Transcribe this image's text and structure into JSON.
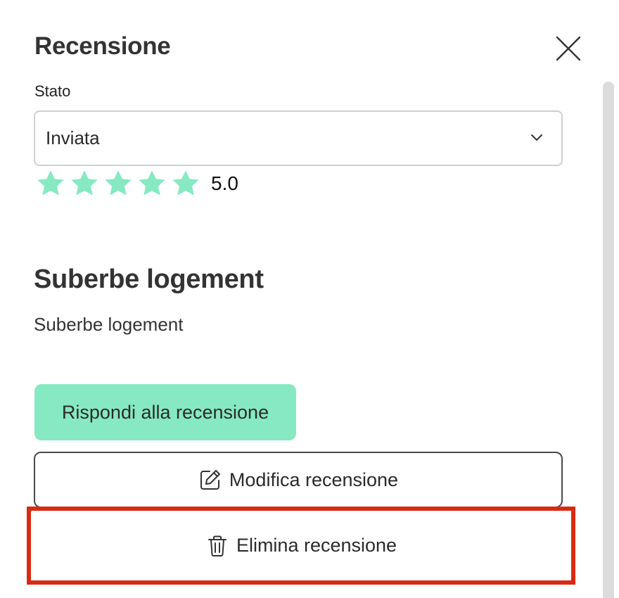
{
  "panel": {
    "title": "Recensione",
    "close_icon": "close-icon"
  },
  "status_field": {
    "label": "Stato",
    "selected_value": "Inviata",
    "chevron_icon": "chevron-down-icon"
  },
  "rating": {
    "stars_filled": 5,
    "stars_total": 5,
    "value_text": "5.0",
    "star_color": "#86e9c3",
    "star_icon": "star-icon"
  },
  "review": {
    "title": "Suberbe logement",
    "body": "Suberbe logement"
  },
  "actions": {
    "reply_label": "Rispondi alla recensione",
    "reply_color": "#86e9c3",
    "edit_label": "Modifica recensione",
    "edit_icon": "edit-icon",
    "delete_label": "Elimina recensione",
    "delete_icon": "trash-icon",
    "highlight_color": "#d92a14"
  }
}
